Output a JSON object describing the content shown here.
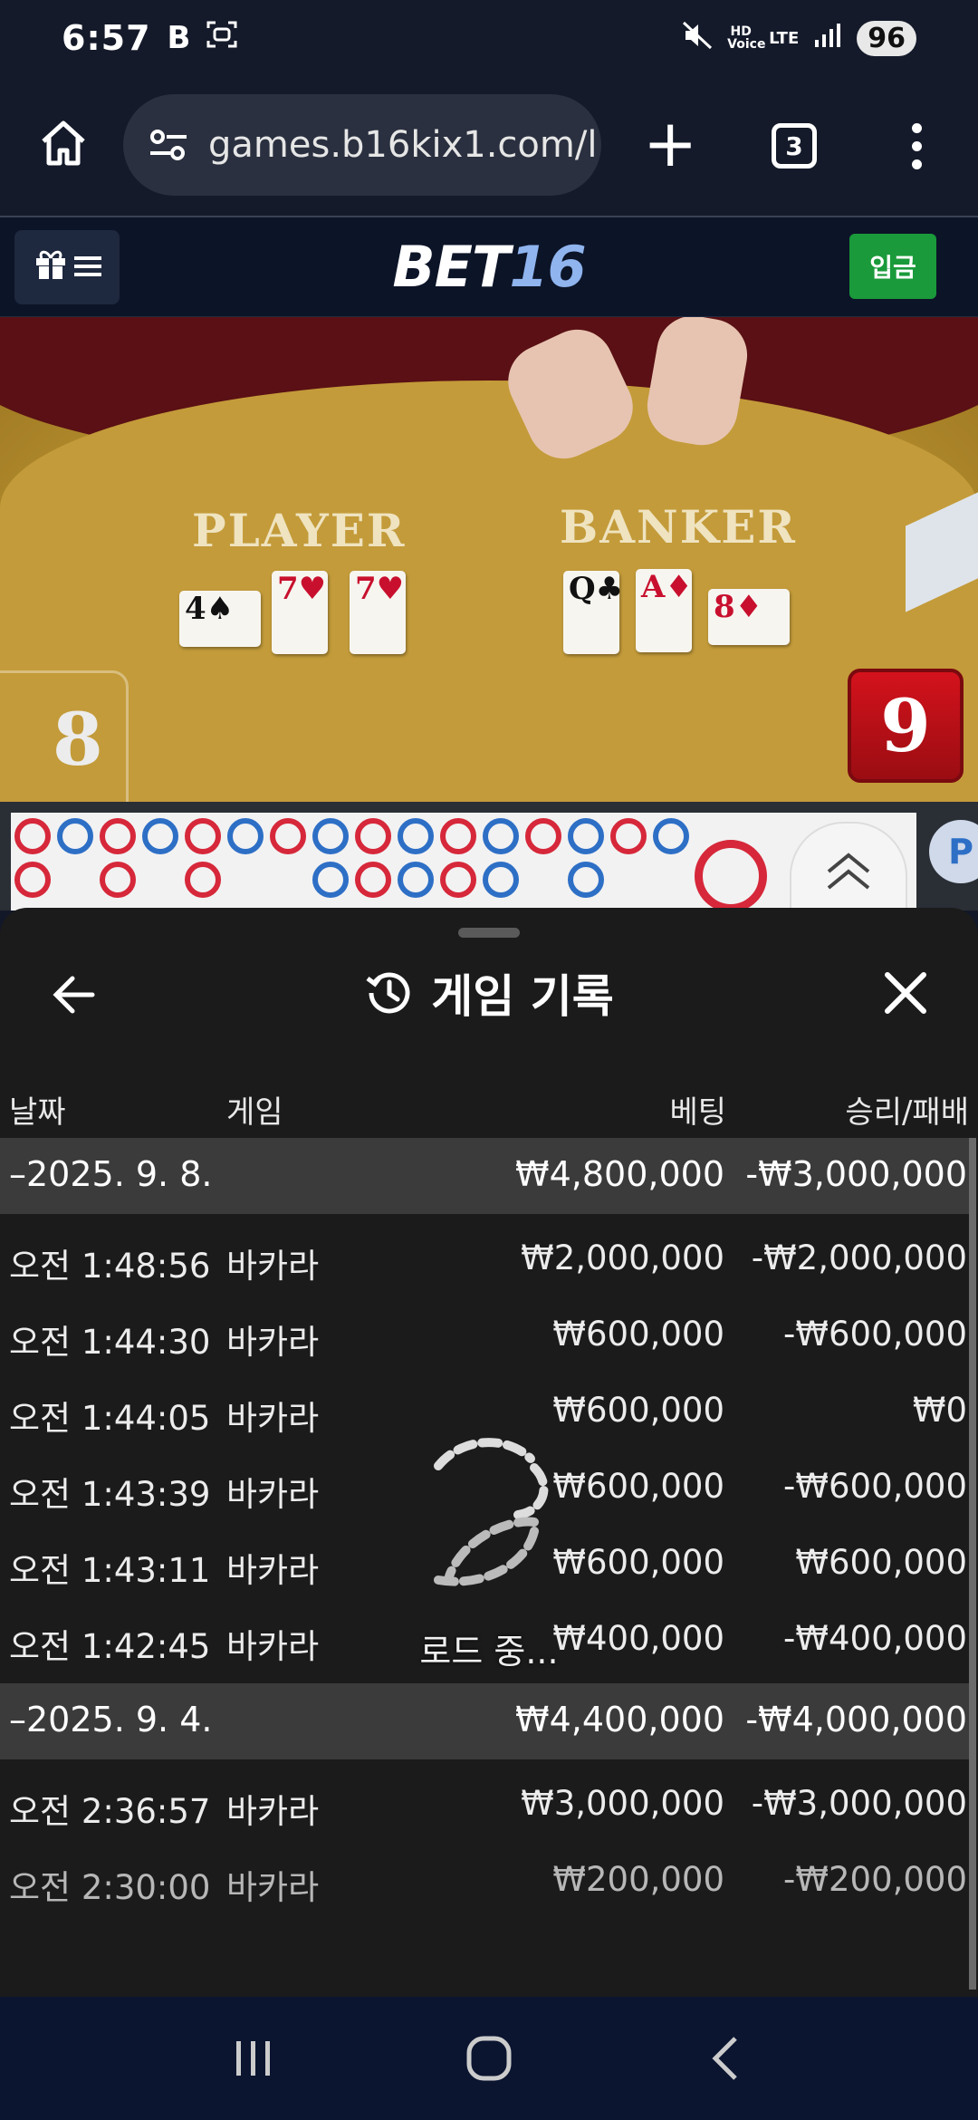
{
  "status_bar": {
    "time": "6:57",
    "icons": [
      "b-app-icon",
      "screen-record-icon",
      "mute-icon",
      "hd-voice-icon",
      "lte-icon",
      "signal-icon"
    ],
    "hd_voice": "HD Voice",
    "network": "LTE",
    "battery": "96"
  },
  "browser": {
    "url": "games.b16kix1.com/l",
    "tab_count": "3"
  },
  "site": {
    "logo_part1": "BET",
    "logo_part2": "16",
    "deposit_label": "입금",
    "brand_green": "#1a9a3a",
    "header_bg": "#0c1428"
  },
  "video": {
    "player_label": "PLAYER",
    "banker_label": "BANKER",
    "player_cards": [
      {
        "rank": "4",
        "suit": "♠",
        "color": "black"
      },
      {
        "rank": "7",
        "suit": "♥",
        "color": "red"
      },
      {
        "rank": "7",
        "suit": "♥",
        "color": "red"
      }
    ],
    "banker_cards": [
      {
        "rank": "Q",
        "suit": "♣",
        "color": "black"
      },
      {
        "rank": "A",
        "suit": "♦",
        "color": "red"
      },
      {
        "rank": "8",
        "suit": "♦",
        "color": "red"
      }
    ],
    "player_score": "8",
    "banker_score": "9"
  },
  "road": {
    "p_button": "P"
  },
  "history": {
    "title": "게임 기록",
    "columns": {
      "date": "날짜",
      "game": "게임",
      "bet": "베팅",
      "win_loss": "승리/패배"
    },
    "groups": [
      {
        "date": "–2025. 9. 8.",
        "bet": "₩4,800,000",
        "win_loss": "-₩3,000,000",
        "rows": [
          {
            "time": "오전 1:48:56",
            "game": "바카라",
            "bet": "₩2,000,000",
            "win_loss": "-₩2,000,000"
          },
          {
            "time": "오전 1:44:30",
            "game": "바카라",
            "bet": "₩600,000",
            "win_loss": "-₩600,000"
          },
          {
            "time": "오전 1:44:05",
            "game": "바카라",
            "bet": "₩600,000",
            "win_loss": "₩0"
          },
          {
            "time": "오전 1:43:39",
            "game": "바카라",
            "bet": "₩600,000",
            "win_loss": "-₩600,000"
          },
          {
            "time": "오전 1:43:11",
            "game": "바카라",
            "bet": "₩600,000",
            "win_loss": "₩600,000"
          },
          {
            "time": "오전 1:42:45",
            "game": "바카라",
            "bet": "₩400,000",
            "win_loss": "-₩400,000"
          }
        ]
      },
      {
        "date": "–2025. 9. 4.",
        "bet": "₩4,400,000",
        "win_loss": "-₩4,000,000",
        "rows": [
          {
            "time": "오전 2:36:57",
            "game": "바카라",
            "bet": "₩3,000,000",
            "win_loss": "-₩3,000,000"
          },
          {
            "time": "오전 2:30:00",
            "game": "바카라",
            "bet": "₩200,000",
            "win_loss": "-₩200,000"
          }
        ]
      }
    ],
    "loading_text": "로드 중..."
  }
}
